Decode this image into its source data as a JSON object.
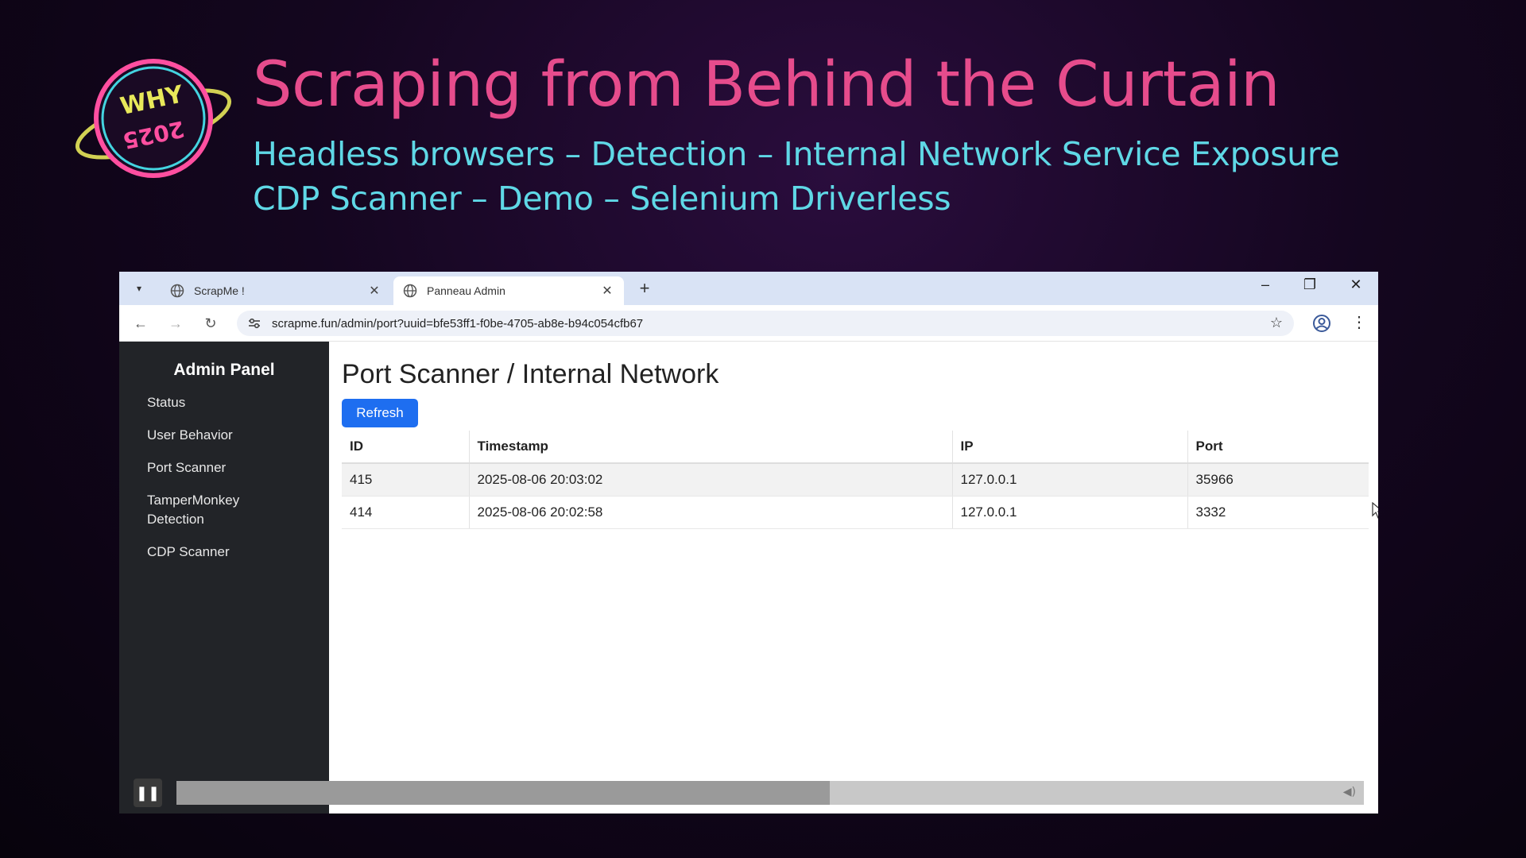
{
  "slide": {
    "title": "Scraping from Behind the Curtain",
    "subtitle_line1": "Headless browsers – Detection – Internal Network Service Exposure",
    "subtitle_line2": "CDP Scanner – Demo – Selenium Driverless",
    "logo_text": "WHY 2025"
  },
  "browser": {
    "tabs": [
      {
        "title": "ScrapMe !",
        "active": false
      },
      {
        "title": "Panneau Admin",
        "active": true
      }
    ],
    "new_tab_label": "+",
    "url": "scrapme.fun/admin/port?uuid=bfe53ff1-f0be-4705-ab8e-b94c054cfb67"
  },
  "sidebar": {
    "title": "Admin Panel",
    "items": [
      {
        "label": "Status"
      },
      {
        "label": "User Behavior"
      },
      {
        "label": "Port Scanner"
      },
      {
        "label": "TamperMonkey Detection"
      },
      {
        "label": "CDP Scanner"
      }
    ]
  },
  "main": {
    "title": "Port Scanner / Internal Network",
    "refresh_label": "Refresh",
    "table": {
      "headers": [
        "ID",
        "Timestamp",
        "IP",
        "Port"
      ],
      "rows": [
        [
          "415",
          "2025-08-06 20:03:02",
          "127.0.0.1",
          "35966"
        ],
        [
          "414",
          "2025-08-06 20:02:58",
          "127.0.0.1",
          "3332"
        ]
      ]
    }
  },
  "media": {
    "progress": 0.55
  },
  "colors": {
    "title_pink": "#e64c8c",
    "subtitle_cyan": "#5fd8e6",
    "sidebar_bg": "#222428",
    "button_blue": "#1e6ef0"
  }
}
